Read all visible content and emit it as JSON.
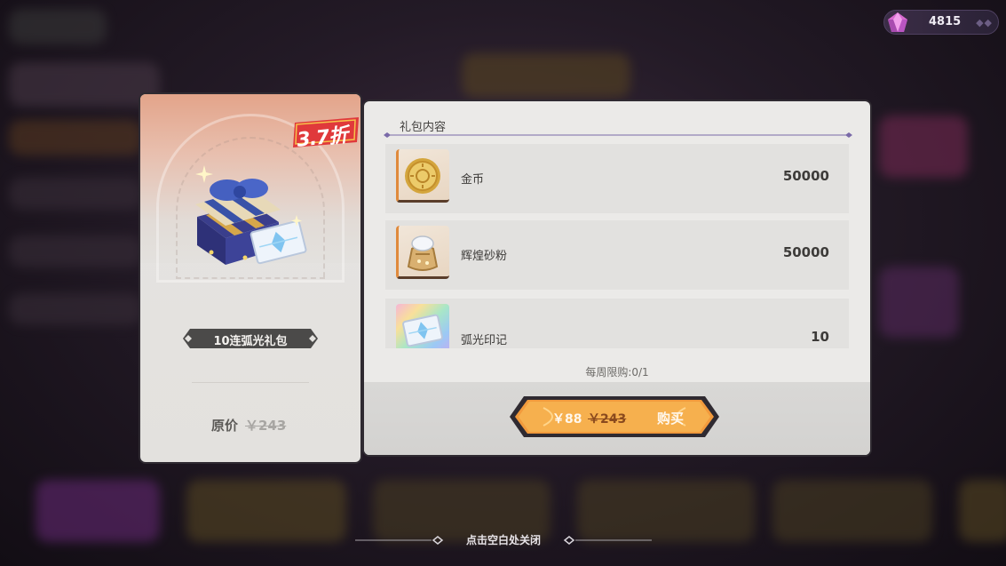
{
  "currency": {
    "icon": "gem-icon",
    "amount": "4815"
  },
  "pack": {
    "discount_badge": "3.7折",
    "name": "10连弧光礼包",
    "original_price_label": "原价",
    "original_price": "￥243"
  },
  "contents": {
    "title": "礼包内容",
    "items": [
      {
        "name": "金币",
        "quantity": "50000",
        "icon": "gold-coin-icon"
      },
      {
        "name": "辉煌砂粉",
        "quantity": "50000",
        "icon": "sand-powder-bag-icon"
      },
      {
        "name": "弧光印记",
        "quantity": "10",
        "icon": "arc-ticket-icon"
      }
    ],
    "weekly_limit": "每周限购:0/1"
  },
  "buy": {
    "price": "￥88",
    "original_price": "￥243",
    "label": "购买"
  },
  "close_hint": "点击空白处关闭",
  "colors": {
    "accent_orange": "#f29a3c",
    "badge_red": "#e0393b",
    "divider_purple": "#7a6aa8"
  }
}
